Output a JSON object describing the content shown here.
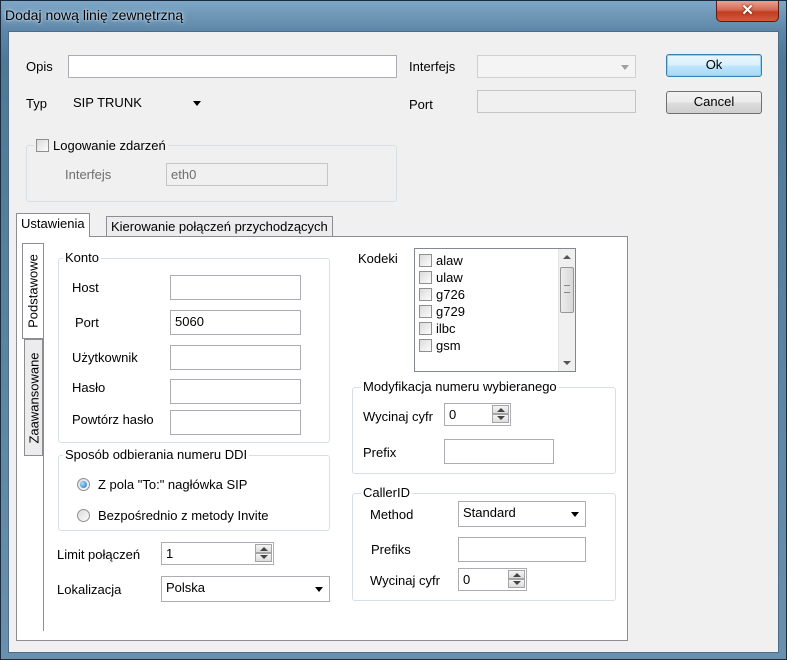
{
  "window": {
    "title": "Dodaj nową linię zewnętrzną",
    "close_glyph": "✕"
  },
  "top": {
    "opis_label": "Opis",
    "opis_value": "",
    "typ_label": "Typ",
    "typ_value": "SIP TRUNK",
    "interfejs_label": "Interfejs",
    "interfejs_value": "",
    "port_label": "Port",
    "port_value": "",
    "ok_label": "Ok",
    "cancel_label": "Cancel"
  },
  "logging": {
    "checkbox_label": "Logowanie zdarzeń",
    "checked": false,
    "interfejs_label": "Interfejs",
    "interfejs_value": "eth0"
  },
  "tabs": [
    {
      "label": "Ustawienia",
      "active": true
    },
    {
      "label": "Kierowanie połączeń przychodzących",
      "active": false
    }
  ],
  "side_tabs": [
    {
      "label": "Podstawowe",
      "active": true
    },
    {
      "label": "Zaawansowane",
      "active": false
    }
  ],
  "konto": {
    "title": "Konto",
    "host_label": "Host",
    "host_value": "",
    "port_label": "Port",
    "port_value": "5060",
    "user_label": "Użytkownik",
    "user_value": "",
    "pass_label": "Hasło",
    "pass_value": "",
    "pass2_label": "Powtórz hasło",
    "pass2_value": ""
  },
  "ddi": {
    "title": "Sposób odbierania numeru DDI",
    "option1": "Z pola \"To:\" nagłówka SIP",
    "option2": "Bezpośrednio z metody Invite",
    "selected": 1
  },
  "limit": {
    "label": "Limit połączeń",
    "value": "1"
  },
  "lokalizacja": {
    "label": "Lokalizacja",
    "value": "Polska"
  },
  "kodeki": {
    "label": "Kodeki",
    "items": [
      "alaw",
      "ulaw",
      "g726",
      "g729",
      "ilbc",
      "gsm"
    ]
  },
  "modyfikacja": {
    "title": "Modyfikacja numeru wybieranego",
    "wycinaj_label": "Wycinaj cyfr",
    "wycinaj_value": "0",
    "prefix_label": "Prefix",
    "prefix_value": ""
  },
  "callerid": {
    "title": "CallerID",
    "method_label": "Method",
    "method_value": "Standard",
    "prefiks_label": "Prefiks",
    "prefiks_value": "",
    "wycinaj_label": "Wycinaj cyfr",
    "wycinaj_value": "0"
  }
}
